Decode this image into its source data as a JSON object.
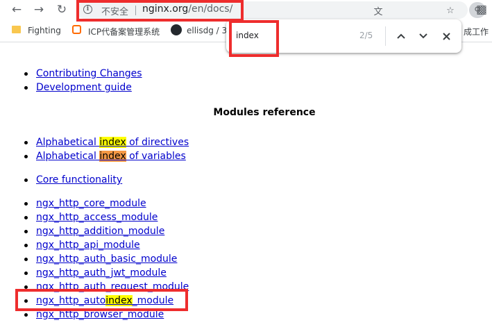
{
  "browser": {
    "insecure_label": "不安全",
    "url_host": "nginx.org",
    "url_path": "/en/docs/",
    "nav_icons": [
      "back-icon",
      "forward-icon",
      "reload-icon"
    ]
  },
  "bookmarks": {
    "items": [
      {
        "label": "Fighting",
        "icon": "folder-icon"
      },
      {
        "label": "ICP代备案管理系统",
        "icon": "icp-icon"
      },
      {
        "label": "ellisdg / 3",
        "icon": "github-icon"
      }
    ],
    "right_label": "成工作"
  },
  "find_bar": {
    "query": "index",
    "count": "2/5"
  },
  "page": {
    "dev_links": [
      "Contributing Changes",
      "Development guide"
    ],
    "modules_heading": "Modules reference",
    "index_links": [
      {
        "pre": "Alphabetical ",
        "match": "index",
        "post": " of directives"
      },
      {
        "pre": "Alphabetical ",
        "match": "index",
        "post": " of variables"
      }
    ],
    "core_link": "Core functionality",
    "modules": [
      "ngx_http_core_module",
      "ngx_http_access_module",
      "ngx_http_addition_module",
      "ngx_http_api_module",
      "ngx_http_auth_basic_module",
      "ngx_http_auth_jwt_module",
      "ngx_http_auth_request_module"
    ],
    "autoindex_link": {
      "pre": "ngx_http_auto",
      "match": "index",
      "post": "_module"
    },
    "browser_module": "ngx_http_browser_module"
  },
  "colors": {
    "link": "#0000cc",
    "highlight": "#ffff00",
    "active_highlight": "#f59945",
    "annotation_red": "#ee2d2d"
  }
}
